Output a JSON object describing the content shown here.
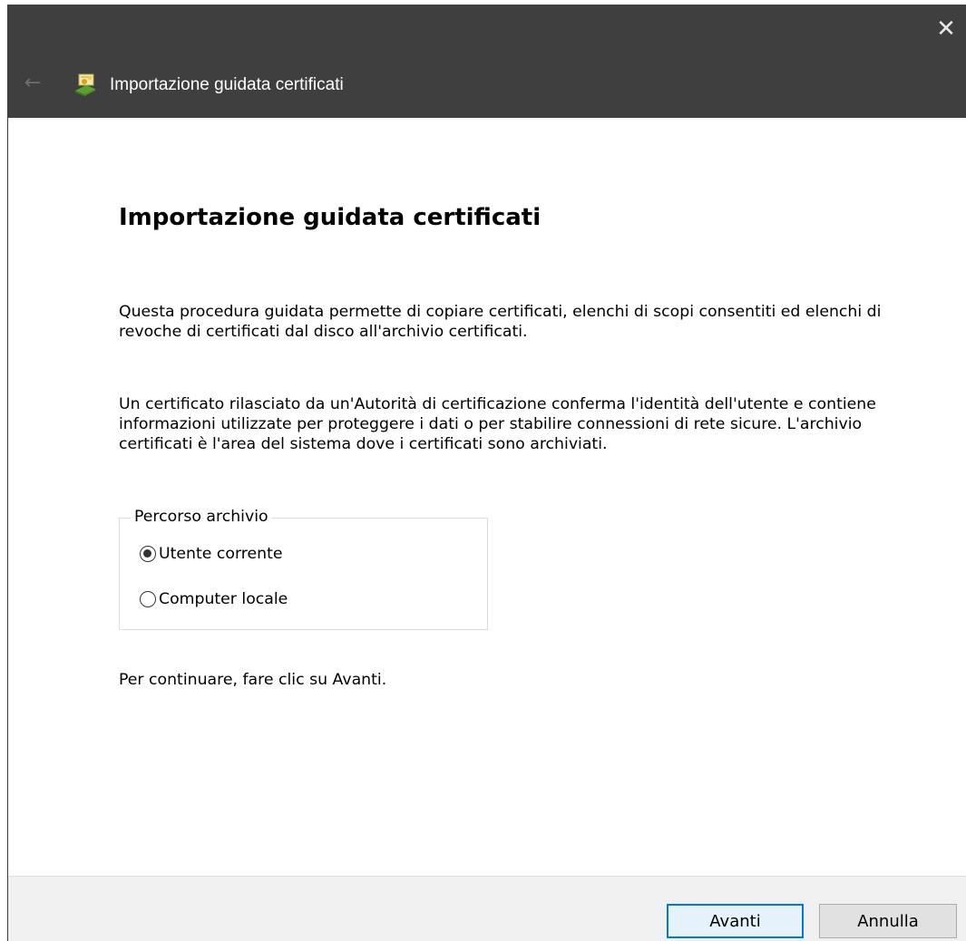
{
  "window": {
    "title": "Importazione guidata certificati",
    "close_glyph": "✕",
    "back_glyph": "←",
    "icon": "certificate-wizard-icon"
  },
  "main": {
    "heading": "Importazione guidata certificati",
    "paragraph1": "Questa procedura guidata permette di copiare certificati, elenchi di scopi consentiti ed elenchi di revoche di certificati dal disco all'archivio certificati.",
    "paragraph2": "Un certificato rilasciato da un'Autorità di certificazione conferma l'identità dell'utente e contiene informazioni utilizzate per proteggere i dati o per stabilire connessioni di rete sicure. L'archivio certificati è l'area del sistema dove i certificati sono archiviati.",
    "store_location": {
      "legend": "Percorso archivio",
      "options": [
        {
          "label": "Utente corrente",
          "selected": true
        },
        {
          "label": "Computer locale",
          "selected": false
        }
      ]
    },
    "continue_text": "Per continuare, fare clic su Avanti."
  },
  "footer": {
    "next_label": "Avanti",
    "cancel_label": "Annulla"
  },
  "colors": {
    "titlebar": "#3f3f3f",
    "accent": "#0078d7",
    "footer_bg": "#f0f0f0"
  }
}
